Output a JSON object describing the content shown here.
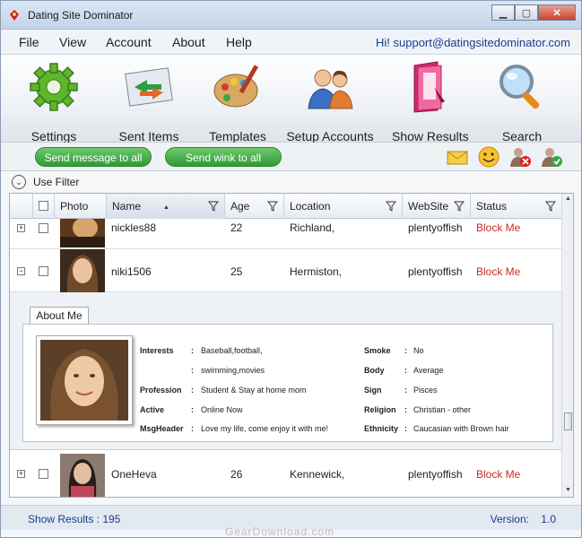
{
  "window": {
    "title": "Dating Site Dominator"
  },
  "menu": {
    "items": [
      "File",
      "View",
      "Account",
      "About",
      "Help"
    ],
    "greeting": "Hi! support@datingsitedominator.com"
  },
  "toolbar": {
    "items": [
      {
        "label": "Settings",
        "icon": "gear-icon"
      },
      {
        "label": "Sent Items",
        "icon": "envelope-arrows-icon"
      },
      {
        "label": "Templates",
        "icon": "palette-icon"
      },
      {
        "label": "Setup Accounts",
        "icon": "users-icon"
      },
      {
        "label": "Show Results",
        "icon": "folder-icon"
      },
      {
        "label": "Search",
        "icon": "magnifier-icon"
      }
    ]
  },
  "actions": {
    "send_message": "Send message to all",
    "send_wink": "Send wink to all"
  },
  "filter": {
    "label": "Use Filter"
  },
  "grid": {
    "columns": [
      "Photo",
      "Name",
      "Age",
      "Location",
      "WebSite",
      "Status"
    ],
    "rows": [
      {
        "name": "nickles88",
        "age": "22",
        "location": "Richland,",
        "website": "plentyoffish",
        "status": "Block Me",
        "expander": "+"
      },
      {
        "name": "niki1506",
        "age": "25",
        "location": "Hermiston,",
        "website": "plentyoffish",
        "status": "Block Me",
        "expander": "−"
      },
      {
        "name": "OneHeva",
        "age": "26",
        "location": "Kennewick,",
        "website": "plentyoffish",
        "status": "Block Me",
        "expander": "+"
      }
    ]
  },
  "details": {
    "tab": "About Me",
    "left": [
      {
        "label": "Interests",
        "value": "Baseball,football,"
      },
      {
        "label": "",
        "value": "swimming,movies"
      },
      {
        "label": "Profession",
        "value": "Student & Stay at home mom"
      },
      {
        "label": "Active",
        "value": "Online Now"
      },
      {
        "label": "MsgHeader",
        "value": "Love my life, come enjoy it with me!"
      }
    ],
    "right": [
      {
        "label": "Smoke",
        "value": "No"
      },
      {
        "label": "Body",
        "value": "Average"
      },
      {
        "label": "Sign",
        "value": "Pisces"
      },
      {
        "label": "Religion",
        "value": "Christian - other"
      },
      {
        "label": "Ethnicity",
        "value": "Caucasian with Brown hair"
      }
    ]
  },
  "status": {
    "results": "Show Results : 195",
    "version": "Version:    1.0"
  },
  "watermark": "GearDownload.com",
  "colors": {
    "accent_green": "#2f9a35",
    "block_red": "#cc2a22",
    "link_blue": "#1a3d8f"
  }
}
